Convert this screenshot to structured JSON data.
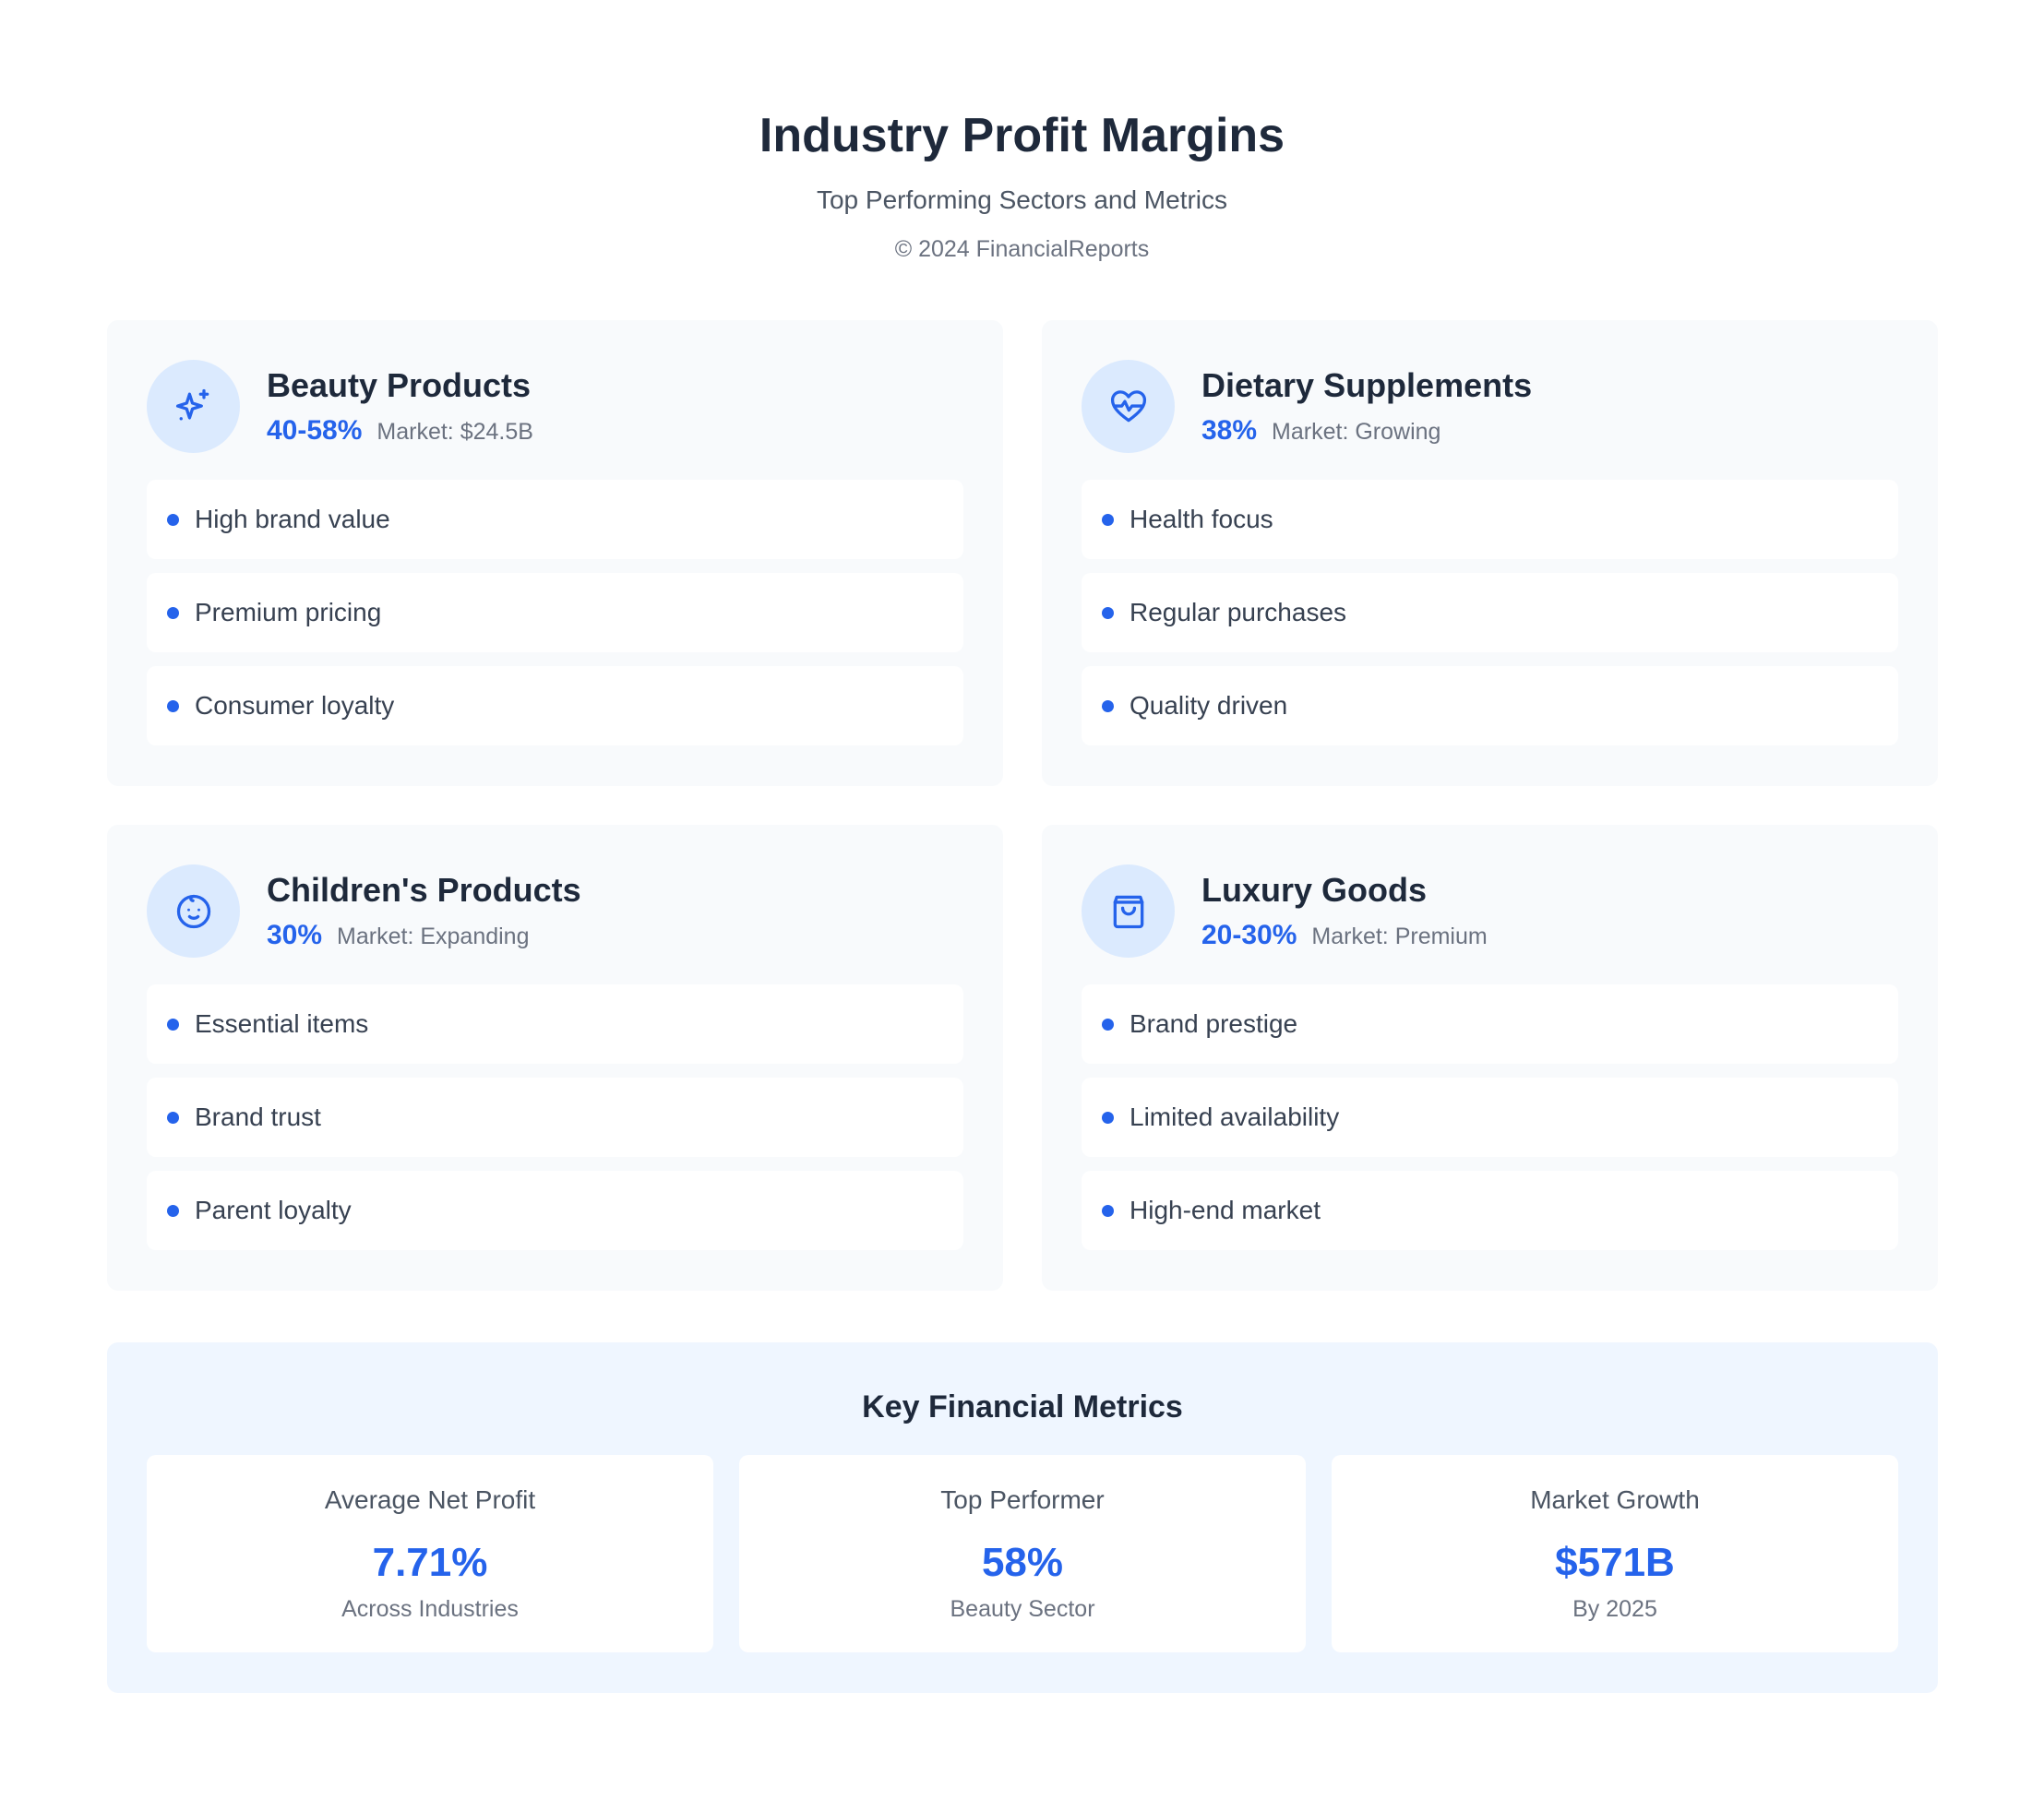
{
  "header": {
    "title": "Industry Profit Margins",
    "subtitle": "Top Performing Sectors and Metrics",
    "copyright": "© 2024 FinancialReports"
  },
  "sectors": [
    {
      "icon": "sparkles-icon",
      "name": "Beauty Products",
      "margin": "40-58%",
      "market": "Market: $24.5B",
      "features": [
        "High brand value",
        "Premium pricing",
        "Consumer loyalty"
      ]
    },
    {
      "icon": "heart-pulse-icon",
      "name": "Dietary Supplements",
      "margin": "38%",
      "market": "Market: Growing",
      "features": [
        "Health focus",
        "Regular purchases",
        "Quality driven"
      ]
    },
    {
      "icon": "baby-face-icon",
      "name": "Children's Products",
      "margin": "30%",
      "market": "Market: Expanding",
      "features": [
        "Essential items",
        "Brand trust",
        "Parent loyalty"
      ]
    },
    {
      "icon": "shopping-bag-icon",
      "name": "Luxury Goods",
      "margin": "20-30%",
      "market": "Market: Premium",
      "features": [
        "Brand prestige",
        "Limited availability",
        "High-end market"
      ]
    }
  ],
  "metrics": {
    "title": "Key Financial Metrics",
    "items": [
      {
        "label": "Average Net Profit",
        "value": "7.71%",
        "note": "Across Industries"
      },
      {
        "label": "Top Performer",
        "value": "58%",
        "note": "Beauty Sector"
      },
      {
        "label": "Market Growth",
        "value": "$571B",
        "note": "By 2025"
      }
    ]
  },
  "colors": {
    "accent": "#2563eb",
    "icon_bg": "#dbeafe",
    "card_bg": "#f8fafc",
    "metrics_bg": "#eff6ff"
  }
}
